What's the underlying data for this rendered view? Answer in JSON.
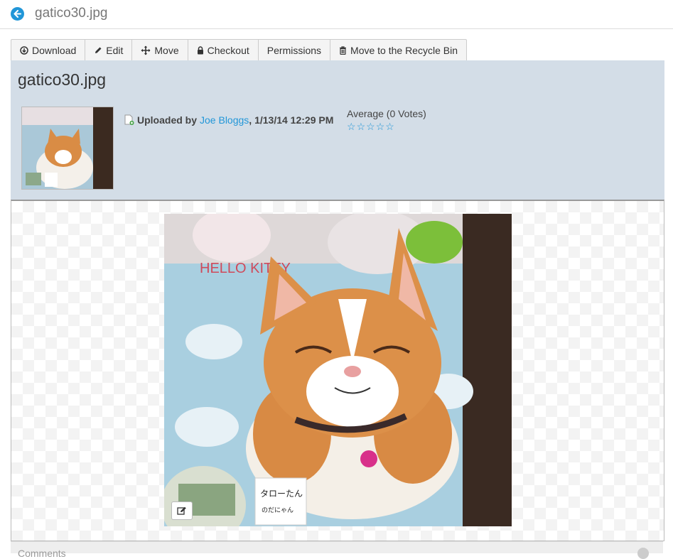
{
  "page": {
    "title": "gatico30.jpg"
  },
  "toolbar": {
    "download_label": "Download",
    "edit_label": "Edit",
    "move_label": "Move",
    "checkout_label": "Checkout",
    "permissions_label": "Permissions",
    "recycle_label": "Move to the Recycle Bin"
  },
  "header": {
    "title": "gatico30.jpg",
    "uploaded_prefix": "Uploaded by",
    "uploader": "Joe Bloggs",
    "uploaded_date": ", 1/13/14 12:29 PM",
    "rating_label": "Average (0 Votes)",
    "rating_stars": 0,
    "rating_max": 5
  },
  "preview": {
    "photo_caption_1": "タローたん",
    "photo_caption_2": "のだにゃん",
    "photo_banner": "HELLO KITTY"
  },
  "comments": {
    "label": "Comments"
  },
  "colors": {
    "accent": "#2196d8",
    "header_bg": "#d3dde7"
  },
  "icons": [
    "back-arrow-icon",
    "download-icon",
    "pencil-icon",
    "move-icon",
    "lock-icon",
    "trash-icon",
    "file-add-icon",
    "star-outline-icon",
    "edit-icon"
  ]
}
